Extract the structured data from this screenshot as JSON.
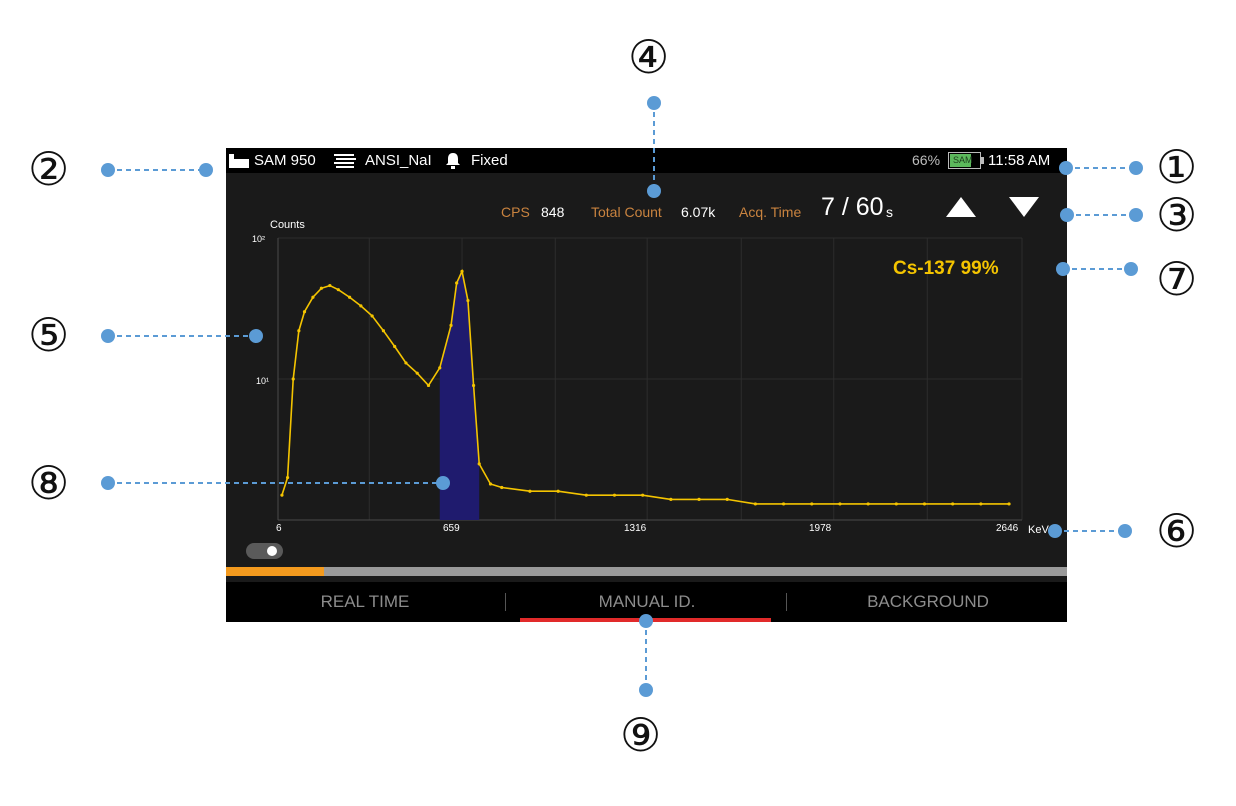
{
  "status_bar": {
    "detector": "SAM 950",
    "library": "ANSI_NaI",
    "mode": "Fixed",
    "battery_percent": "66%",
    "battery_label": "SAM",
    "time": "11:58 AM"
  },
  "metrics": {
    "cps_label": "CPS",
    "cps_value": "848",
    "total_count_label": "Total Count",
    "total_count_value": "6.07k",
    "acq_time_label": "Acq. Time",
    "acq_time_value": "7 / 60",
    "acq_time_unit": "s"
  },
  "identification": "Cs-137  99%",
  "chart_data": {
    "type": "line",
    "ylabel": "Counts",
    "xlabel": "KeV",
    "y_scale": "log",
    "y_ticks": [
      "10²",
      "10¹"
    ],
    "x_ticks": [
      "6",
      "659",
      "1316",
      "1978",
      "2646"
    ],
    "xlim": [
      6,
      2646
    ],
    "grid": true,
    "highlighted_region": [
      580,
      720
    ],
    "series": [
      {
        "x": [
          20,
          40,
          60,
          80,
          100,
          130,
          160,
          190,
          220,
          260,
          300,
          340,
          380,
          420,
          460,
          500,
          540,
          580,
          620,
          640,
          659,
          680,
          700,
          720,
          760,
          800,
          900,
          1000,
          1100,
          1200,
          1300,
          1400,
          1500,
          1600,
          1700,
          1800,
          1900,
          2000,
          2100,
          2200,
          2300,
          2400,
          2500,
          2600
        ],
        "y": [
          1.5,
          2.0,
          10,
          22,
          30,
          38,
          44,
          46,
          43,
          38,
          33,
          28,
          22,
          17,
          13,
          11,
          9,
          12,
          24,
          48,
          58,
          36,
          9,
          2.5,
          1.8,
          1.7,
          1.6,
          1.6,
          1.5,
          1.5,
          1.5,
          1.4,
          1.4,
          1.4,
          1.3,
          1.3,
          1.3,
          1.3,
          1.3,
          1.3,
          1.3,
          1.3,
          1.3,
          1.3
        ]
      }
    ]
  },
  "toggle_state": "on",
  "acquisition_progress": 0.117,
  "tabs": [
    "REAL TIME",
    "MANUAL ID.",
    "BACKGROUND"
  ],
  "active_tab": "MANUAL ID.",
  "callouts": [
    "①",
    "②",
    "③",
    "④",
    "⑤",
    "⑥",
    "⑦",
    "⑧",
    "⑨"
  ],
  "colors": {
    "spectrum": "#f4c400",
    "peak_region": "#1f1b6e",
    "label": "#c9833f",
    "progress": "#f39a1e",
    "tab_underline": "#e12a2a",
    "callout_line": "#5b9bd5"
  }
}
